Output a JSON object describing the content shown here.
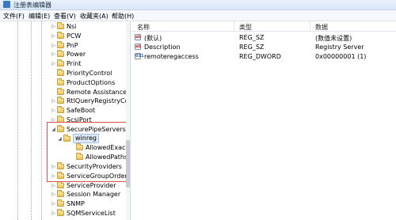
{
  "window": {
    "title": "注册表编辑器"
  },
  "menu": [
    "文件(F)",
    "编辑(E)",
    "查看(V)",
    "收藏夹(A)",
    "帮助(H)"
  ],
  "tree": {
    "items": [
      {
        "label": "Nsi",
        "level": 1,
        "toggle": "▷"
      },
      {
        "label": "PCW",
        "level": 1,
        "toggle": "▷"
      },
      {
        "label": "PnP",
        "level": 1,
        "toggle": "▷"
      },
      {
        "label": "Power",
        "level": 1,
        "toggle": "▷"
      },
      {
        "label": "Print",
        "level": 1,
        "toggle": "▷"
      },
      {
        "label": "PriorityControl",
        "level": 1,
        "toggle": ""
      },
      {
        "label": "ProductOptions",
        "level": 1,
        "toggle": ""
      },
      {
        "label": "Remote Assistance",
        "level": 1,
        "toggle": ""
      },
      {
        "label": "RtlQueryRegistryCon",
        "level": 1,
        "toggle": "▷"
      },
      {
        "label": "SafeBoot",
        "level": 1,
        "toggle": "▷"
      },
      {
        "label": "ScsiPort",
        "level": 1,
        "toggle": "▷"
      },
      {
        "label": "SecurePipeServers",
        "level": 1,
        "toggle": "◢"
      },
      {
        "label": "winreg",
        "level": 2,
        "toggle": "◢",
        "selected": true
      },
      {
        "label": "AllowedExactP",
        "level": 3,
        "toggle": ""
      },
      {
        "label": "AllowedPaths",
        "level": 3,
        "toggle": ""
      },
      {
        "label": "SecurityProviders",
        "level": 1,
        "toggle": "▷"
      },
      {
        "label": "ServiceGroupOrder",
        "level": 1,
        "toggle": "▷"
      },
      {
        "label": "ServiceProvider",
        "level": 1,
        "toggle": "▷"
      },
      {
        "label": "Session Manager",
        "level": 1,
        "toggle": "▷"
      },
      {
        "label": "SNMP",
        "level": 1,
        "toggle": "▷"
      },
      {
        "label": "SQMServiceList",
        "level": 1,
        "toggle": "▷"
      }
    ]
  },
  "list": {
    "columns": [
      "名称",
      "类型",
      "数据"
    ],
    "rows": [
      {
        "name": "(默认)",
        "type": "REG_SZ",
        "data": "(数值未设置)",
        "icon": "ab"
      },
      {
        "name": "Description",
        "type": "REG_SZ",
        "data": "Registry Server",
        "icon": "ab"
      },
      {
        "name": "remoteregaccess",
        "type": "REG_DWORD",
        "data": "0x00000001 (1)",
        "icon": "011"
      }
    ]
  }
}
